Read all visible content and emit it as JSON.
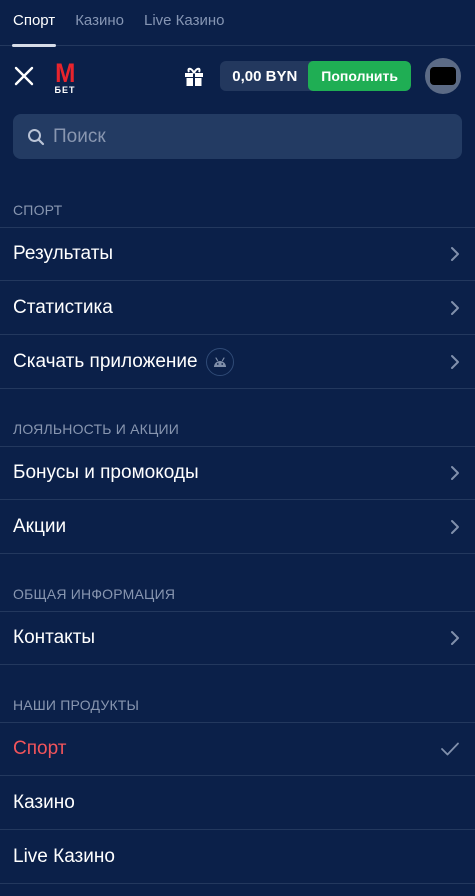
{
  "top_tabs": [
    {
      "label": "Спорт",
      "active": true
    },
    {
      "label": "Казино",
      "active": false
    },
    {
      "label": "Live Казино",
      "active": false
    }
  ],
  "header": {
    "logo_letter": "M",
    "logo_sub": "БЕТ",
    "balance": "0,00 BYN",
    "deposit_label": "Пополнить"
  },
  "search": {
    "placeholder": "Поиск"
  },
  "sections": {
    "sport": {
      "title": "СПОРТ",
      "items": [
        "Результаты",
        "Статистика",
        "Скачать приложение"
      ]
    },
    "loyalty": {
      "title": "ЛОЯЛЬНОСТЬ И АКЦИИ",
      "items": [
        "Бонусы и промокоды",
        "Акции"
      ]
    },
    "info": {
      "title": "ОБЩАЯ ИНФОРМАЦИЯ",
      "items": [
        "Контакты"
      ]
    },
    "products": {
      "title": "НАШИ ПРОДУКТЫ",
      "items": [
        "Спорт",
        "Казино",
        "Live Казино"
      ],
      "selected": "Спорт"
    }
  },
  "colors": {
    "background": "#0b2049",
    "accent_red": "#e8242d",
    "deposit_green": "#1fae54",
    "selected_text": "#f2545b"
  },
  "icons": [
    "close-icon",
    "gift-icon",
    "search-icon",
    "chevron-right-icon",
    "android-icon",
    "check-icon"
  ]
}
